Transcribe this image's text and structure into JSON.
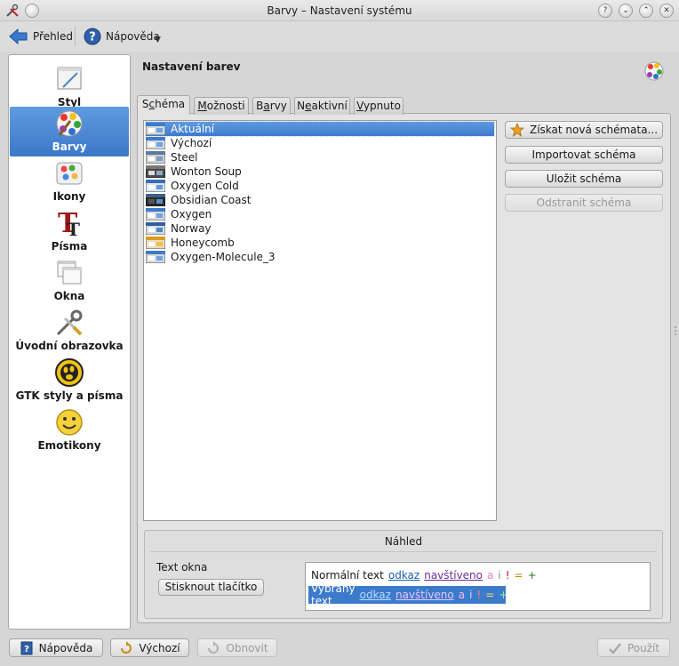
{
  "window": {
    "title": "Barvy – Nastavení systému",
    "controls": {
      "help": "?",
      "minimize": "⌄",
      "maximize": "⌃",
      "close": "✕"
    }
  },
  "toolbar": {
    "overview": "Přehled",
    "help": "Nápověda"
  },
  "sidebar": {
    "items": [
      {
        "label": "Styl",
        "icon": "style-icon"
      },
      {
        "label": "Barvy",
        "icon": "colors-icon",
        "active": true
      },
      {
        "label": "Ikony",
        "icon": "icons-icon"
      },
      {
        "label": "Písma",
        "icon": "fonts-icon"
      },
      {
        "label": "Okna",
        "icon": "windows-icon"
      },
      {
        "label": "Úvodní obrazovka",
        "icon": "splash-screen-icon"
      },
      {
        "label": "GTK styly a písma",
        "icon": "gtk-icon"
      },
      {
        "label": "Emotikony",
        "icon": "emoticons-icon"
      }
    ]
  },
  "main": {
    "heading": "Nastavení barev",
    "tabs": [
      {
        "pre": "S",
        "key": "c",
        "post": "héma",
        "active": true
      },
      {
        "pre": "",
        "key": "M",
        "post": "ožnosti",
        "active": false
      },
      {
        "pre": "B",
        "key": "a",
        "post": "rvy",
        "active": false
      },
      {
        "pre": "N",
        "key": "e",
        "post": "aktivní",
        "active": false
      },
      {
        "pre": "",
        "key": "V",
        "post": "ypnuto",
        "active": false
      }
    ],
    "schemes": [
      "Aktuální",
      "Výchozí",
      "Steel",
      "Wonton Soup",
      "Oxygen Cold",
      "Obsidian Coast",
      "Oxygen",
      "Norway",
      "Honeycomb",
      "Oxygen-Molecule_3"
    ],
    "selected_scheme": "Aktuální",
    "buttons": {
      "get_new": "Získat nová schémata...",
      "import": "Importovat schéma",
      "save": "Uložit schéma",
      "remove": "Odstranit schéma"
    },
    "preview": {
      "title": "Náhled",
      "window_text": "Text okna",
      "push_button": "Stisknout tlačítko",
      "normal_text": "Normální text",
      "selected_text": "Vybraný text",
      "link": "odkaz",
      "visited": "navštíveno",
      "active": "a",
      "inactive": "i",
      "negative": "!",
      "neutral": "=",
      "positive": "+"
    }
  },
  "footer": {
    "help": "Nápověda",
    "defaults": "Výchozí",
    "reset": "Obnovit",
    "apply": "Použít"
  },
  "colors": {
    "selection": "#3c7bcb",
    "link": "#1b5fb3",
    "visited": "#6a2f9a"
  }
}
